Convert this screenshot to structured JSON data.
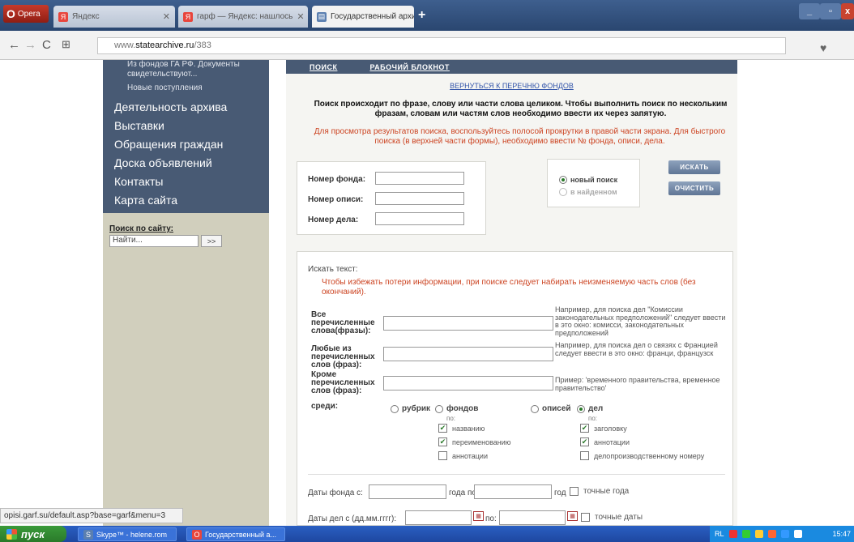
{
  "browser": {
    "menu_label": "Opera",
    "tabs": [
      {
        "label": "Яндекс",
        "icon": "yandex-icon"
      },
      {
        "label": "гарф — Яндекс: нашлось",
        "icon": "yandex-icon"
      },
      {
        "label": "Государственный архив Ро",
        "icon": "document-icon"
      }
    ],
    "new_tab": "+",
    "window_controls": [
      "_",
      "▫",
      "x"
    ],
    "url_prefix": "www.",
    "url_host": "statearchive.ru",
    "url_path": "/383",
    "status_url": "opisi.garf.su/default.asp?base=garf&menu=3"
  },
  "sidebar": {
    "sub_items": [
      "Из фондов ГА РФ. Документы свидетельствуют...",
      "Новые поступления"
    ],
    "menu": [
      "Деятельность архива",
      "Выставки",
      "Обращения граждан",
      "Доска объявлений",
      "Контакты",
      "Карта сайта"
    ],
    "search_label": "Поиск по сайту:",
    "search_value": "Найти...",
    "search_button": ">>"
  },
  "content": {
    "topnav": [
      "ПОИСК",
      "РАБОЧИЙ БЛОКНОТ"
    ],
    "back_link": "ВЕРНУТЬСЯ К ПЕРЕЧНЮ ФОНДОВ",
    "info_bold": "Поиск происходит по фразе, слову или части слова целиком. Чтобы выполнить поиск по нескольким фразам, словам или частям слов необходимо ввести их через запятую.",
    "info_red": "Для просмотра результатов поиска, воспользуйтесь полосой прокрутки в правой части экрана. Для быстрого поиска (в верхней части формы), необходимо ввести № фонда, описи, дела.",
    "fond_label": "Номер фонда:",
    "opis_label": "Номер описи:",
    "delo_label": "Номер дела:",
    "radio_new": "новый поиск",
    "radio_found": "в найденном",
    "search_btn": "ИСКАТЬ",
    "clear_btn": "ОЧИСТИТЬ",
    "text_title": "Искать текст:",
    "text_warning": "Чтобы избежать потери информации, при поиске следует набирать неизменяемую часть слов (без окончаний).",
    "all_label": "Все перечисленные слова(фразы):",
    "all_example": "Например, для поиска дел \"Комиссии законодательных предположений\" следует ввести в это окно: комисси, законодательных предположений",
    "any_label": "Любые из перечисленных слов (фраз):",
    "any_example": "Например, для поиска дел о связях с Францией следует ввести в это окно: франци, французск",
    "except_label": "Кроме перечисленных слов (фраз):",
    "except_example": "Пример: 'временного правительства, временное правительство'",
    "among_label": "среди:",
    "radios": [
      "рубрик",
      "фондов",
      "описей",
      "дел"
    ],
    "po": "по:",
    "fond_checks": [
      {
        "label": "названию",
        "checked": true
      },
      {
        "label": "переименованию",
        "checked": true
      },
      {
        "label": "аннотации",
        "checked": false
      }
    ],
    "delo_checks": [
      {
        "label": "заголовку",
        "checked": true
      },
      {
        "label": "аннотации",
        "checked": true
      },
      {
        "label": "делопроизводственному номеру",
        "checked": false
      }
    ],
    "fond_dates_label": "Даты фонда с:",
    "fond_dates_to": "года по:",
    "fond_dates_year": "год",
    "exact_years": "точные года",
    "delo_dates_label": "Даты дел с (дд.мм.гггг):",
    "delo_dates_to": "по:",
    "exact_dates": "точные даты"
  },
  "taskbar": {
    "start": "пуск",
    "items": [
      "Skype™ - helene.rom",
      "Государственный а..."
    ],
    "lang": "RL",
    "time": "15:47"
  }
}
